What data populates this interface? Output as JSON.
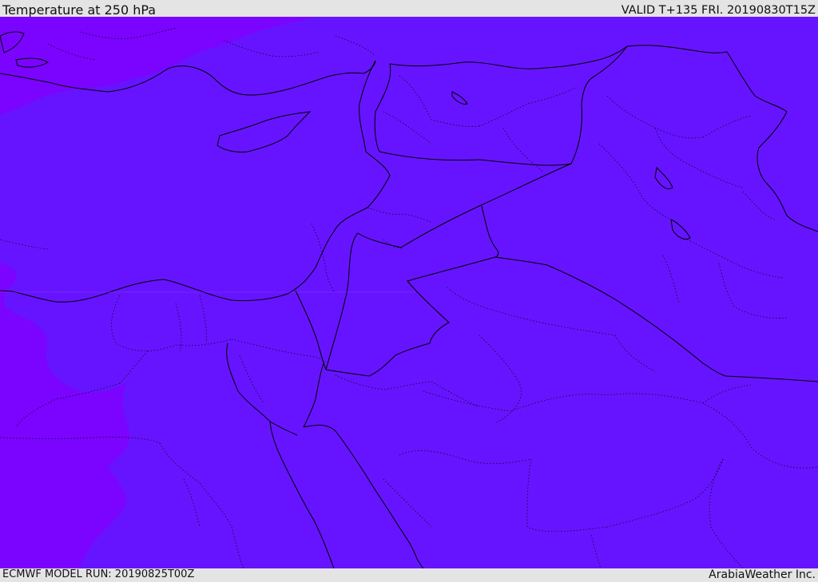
{
  "header": {
    "title": "Temperature at 250 hPa",
    "valid_time": "VALID T+135 FRI. 20190830T15Z"
  },
  "footer": {
    "model_run": "ECMWF MODEL RUN: 20190825T00Z",
    "credit": "ArabiaWeather Inc."
  },
  "colors": {
    "field_main": "#6614ff",
    "field_warm": "#7a04ff",
    "border": "#000000",
    "frame": "#e4e4e4"
  }
}
